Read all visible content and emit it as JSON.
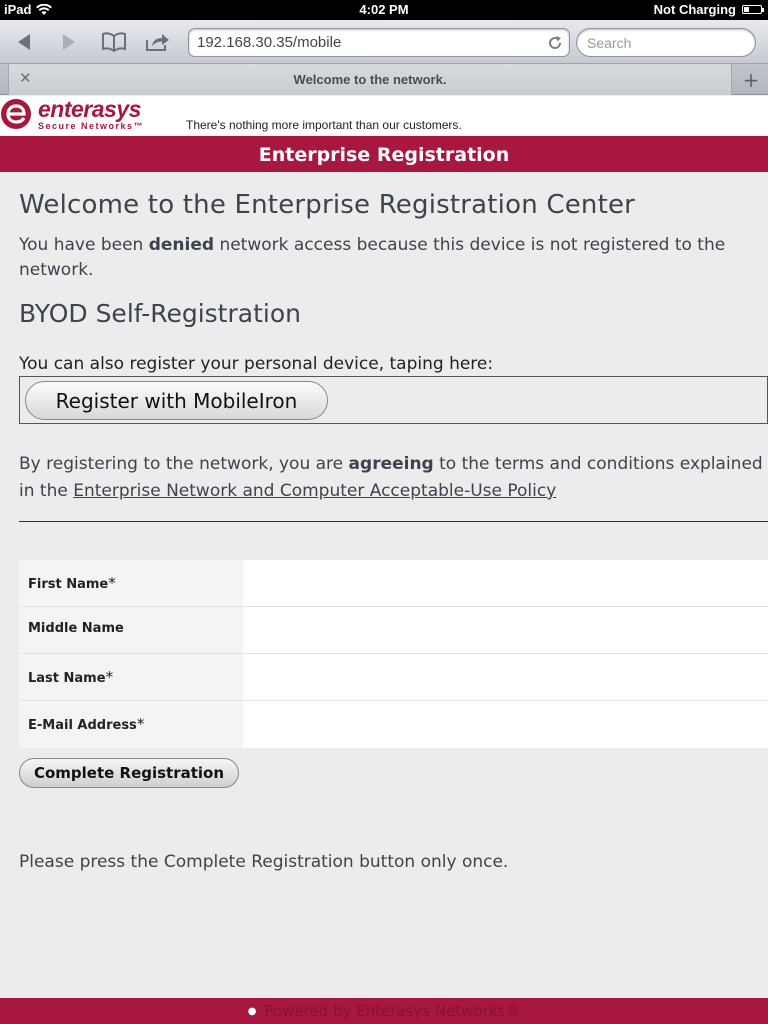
{
  "status_bar": {
    "device": "iPad",
    "time": "4:02 PM",
    "charging": "Not Charging"
  },
  "browser": {
    "url": "192.168.30.35/mobile",
    "search_placeholder": "Search",
    "tab_title": "Welcome to the network."
  },
  "brand": {
    "name": "enterasys",
    "tagline": "Secure Networks™",
    "slogan": "There's nothing more important than our customers.",
    "color": "#a7173f"
  },
  "banner": {
    "title": "Enterprise Registration"
  },
  "main": {
    "heading": "Welcome to the Enterprise Registration Center",
    "denied_prefix": "You have been ",
    "denied_word": "denied",
    "denied_suffix": " network access because this device is not registered to the network.",
    "byod_heading": "BYOD Self-Registration",
    "register_label": "You can also register your personal device, taping here:",
    "register_button": "Register with MobileIron",
    "terms_prefix": "By registering to the network, you are ",
    "terms_bold": "agreeing",
    "terms_middle": " to the terms and conditions explained in the ",
    "terms_link": "Enterprise Network and Computer Acceptable-Use Policy"
  },
  "form": {
    "required_marker": "*",
    "fields": [
      {
        "label": "First Name",
        "required": true,
        "value": ""
      },
      {
        "label": "Middle Name",
        "required": false,
        "value": ""
      },
      {
        "label": "Last Name",
        "required": true,
        "value": ""
      },
      {
        "label": "E-Mail Address",
        "required": true,
        "value": ""
      }
    ],
    "submit_label": "Complete Registration",
    "note": "Please press the Complete Registration button only once."
  },
  "footer": {
    "text": "Powered by Enterasys Networks®"
  }
}
